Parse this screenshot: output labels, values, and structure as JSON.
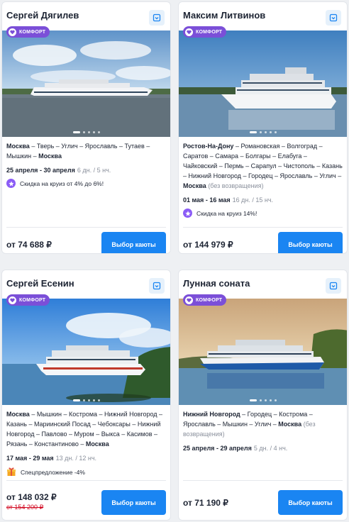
{
  "cards": [
    {
      "name": "Сергей Дягилев",
      "badge": "КОМФОРТ",
      "route_parts": [
        {
          "t": "Москва",
          "b": true
        },
        {
          "t": " – Тверь – Углич – Ярославль – Тутаев – Мышкин – ",
          "b": false
        },
        {
          "t": "Москва",
          "b": true
        }
      ],
      "date_from": "25 апреля",
      "date_sep": " - ",
      "date_to": "30 апреля",
      "duration": "6 дн. / 5 нч.",
      "promo": "Скидка на круиз от 4% до 6%!",
      "promo_icon": "star-icon",
      "price": "от 74 688 ₽",
      "old_price": "",
      "button": "Выбор каюты"
    },
    {
      "name": "Максим Литвинов",
      "badge": "КОМФОРТ",
      "route_parts": [
        {
          "t": "Ростов-На-Дону",
          "b": true
        },
        {
          "t": " – Романовская – Волгоград – Саратов – Самара – Болгары – Елабуга – Чайковский – Пермь – Сарапул – Чистополь – Казань – Нижний Новгород – Городец – Ярославль – Углич – ",
          "b": false
        },
        {
          "t": "Москва",
          "b": true
        },
        {
          "t": " (без возвращения)",
          "b": false,
          "note": true
        }
      ],
      "date_from": "01 мая",
      "date_sep": " - ",
      "date_to": "16 мая",
      "duration": "16 дн. / 15 нч.",
      "promo": "Скидка на круиз 14%!",
      "promo_icon": "star-icon",
      "price": "от 144 979 ₽",
      "old_price": "",
      "button": "Выбор каюты"
    },
    {
      "name": "Сергей Есенин",
      "badge": "КОМФОРТ",
      "route_parts": [
        {
          "t": "Москва",
          "b": true
        },
        {
          "t": " – Мышкин – Кострома – Нижний Новгород – Казань – Мариинский Посад – Чебоксары – Нижний Новгород – Павлово – Муром – Выкса – Касимов – Рязань – Константиново – ",
          "b": false
        },
        {
          "t": "Москва",
          "b": true
        }
      ],
      "date_from": "17 мая",
      "date_sep": " - ",
      "date_to": "29 мая",
      "duration": "13 дн. / 12 нч.",
      "promo": "Спецпредложение -4%",
      "promo_icon": "gift-icon",
      "price": "от 148 032 ₽",
      "old_price": "от 154 200 ₽",
      "button": "Выбор каюты"
    },
    {
      "name": "Лунная соната",
      "badge": "КОМФОРТ",
      "route_parts": [
        {
          "t": "Нижний Новгород",
          "b": true
        },
        {
          "t": " – Городец – Кострома – Ярославль – Мышкин – Углич – ",
          "b": false
        },
        {
          "t": "Москва",
          "b": true
        },
        {
          "t": " (без возвращения)",
          "b": false,
          "note": true
        }
      ],
      "date_from": "25 апреля",
      "date_sep": " - ",
      "date_to": "29 апреля",
      "duration": "5 дн. / 4 нч.",
      "promo": "",
      "promo_icon": "",
      "price": "от 71 190 ₽",
      "old_price": "",
      "button": "Выбор каюты"
    }
  ],
  "colors": {
    "badge": "#7b4fd8",
    "button": "#1a85f2",
    "old_price": "#d0021b",
    "promo_star": "#8b5cf6"
  }
}
